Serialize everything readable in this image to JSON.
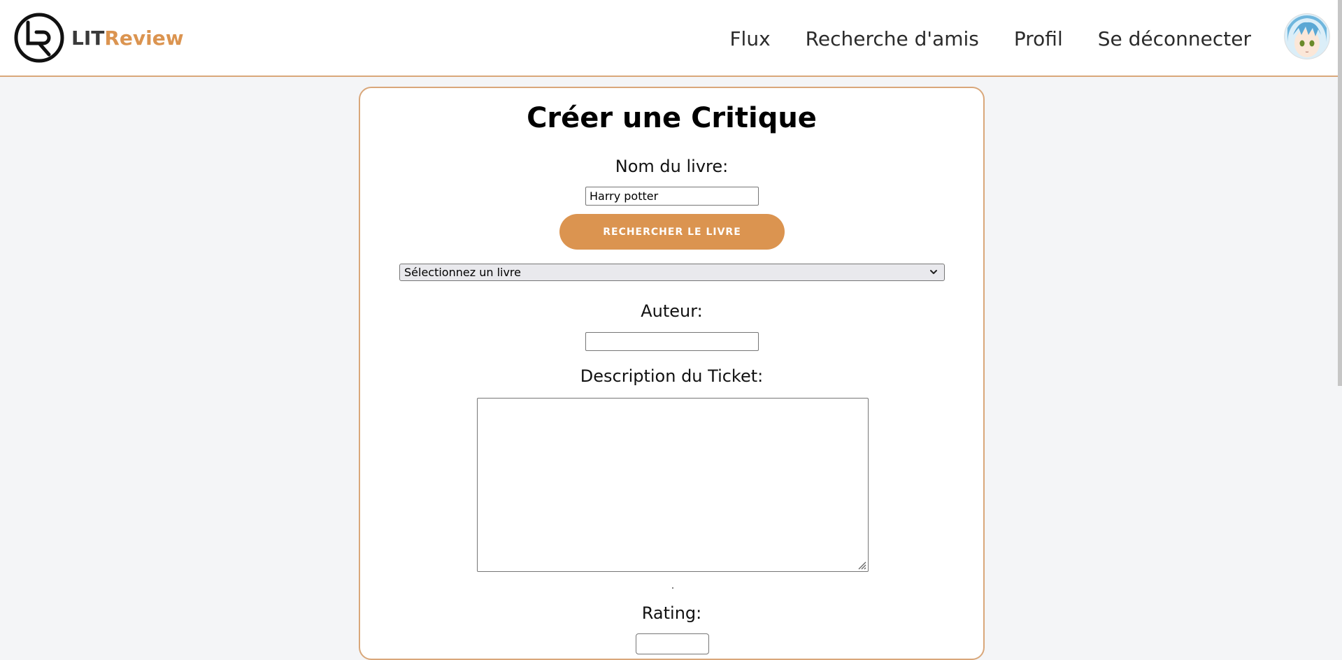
{
  "header": {
    "logo": {
      "part1": "LIT",
      "part2": "Review"
    },
    "nav": [
      {
        "label": "Flux"
      },
      {
        "label": "Recherche d'amis"
      },
      {
        "label": "Profil"
      },
      {
        "label": "Se déconnecter"
      }
    ]
  },
  "form": {
    "title": "Créer une Critique",
    "book_name_label": "Nom du livre:",
    "book_name_value": "Harry potter",
    "search_button": "RECHERCHER LE LIVRE",
    "book_select_value": "Sélectionnez un livre",
    "author_label": "Auteur:",
    "author_value": "",
    "description_label": "Description du Ticket:",
    "description_value": "",
    "rating_label": "Rating:"
  },
  "colors": {
    "accent": "#db9450",
    "border": "#d9a77a",
    "background": "#f4f5f7"
  }
}
